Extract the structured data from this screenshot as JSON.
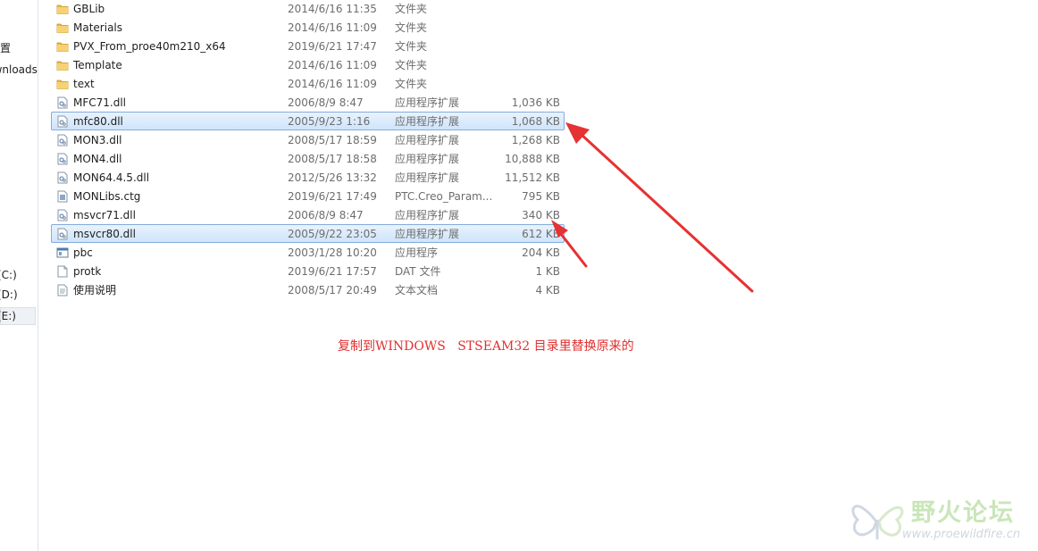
{
  "sidebar": {
    "items": [
      {
        "label": "位置"
      },
      {
        "label": "Downloads"
      },
      {
        "label": "(C:)"
      },
      {
        "label": "(D:)"
      },
      {
        "label": "(E:)"
      }
    ]
  },
  "files": [
    {
      "name": "GBLib",
      "date": "2014/6/16 11:35",
      "type": "文件夹",
      "size": "",
      "icon": "folder-icon",
      "selected": false
    },
    {
      "name": "Materials",
      "date": "2014/6/16 11:09",
      "type": "文件夹",
      "size": "",
      "icon": "folder-icon",
      "selected": false
    },
    {
      "name": "PVX_From_proe40m210_x64",
      "date": "2019/6/21 17:47",
      "type": "文件夹",
      "size": "",
      "icon": "folder-icon",
      "selected": false
    },
    {
      "name": "Template",
      "date": "2014/6/16 11:09",
      "type": "文件夹",
      "size": "",
      "icon": "folder-icon",
      "selected": false
    },
    {
      "name": "text",
      "date": "2014/6/16 11:09",
      "type": "文件夹",
      "size": "",
      "icon": "folder-icon",
      "selected": false
    },
    {
      "name": "MFC71.dll",
      "date": "2006/8/9 8:47",
      "type": "应用程序扩展",
      "size": "1,036 KB",
      "icon": "dll-file-icon",
      "selected": false
    },
    {
      "name": "mfc80.dll",
      "date": "2005/9/23 1:16",
      "type": "应用程序扩展",
      "size": "1,068 KB",
      "icon": "dll-file-icon",
      "selected": true
    },
    {
      "name": "MON3.dll",
      "date": "2008/5/17 18:59",
      "type": "应用程序扩展",
      "size": "1,268 KB",
      "icon": "dll-file-icon",
      "selected": false
    },
    {
      "name": "MON4.dll",
      "date": "2008/5/17 18:58",
      "type": "应用程序扩展",
      "size": "10,888 KB",
      "icon": "dll-file-icon",
      "selected": false
    },
    {
      "name": "MON64.4.5.dll",
      "date": "2012/5/26 13:32",
      "type": "应用程序扩展",
      "size": "11,512 KB",
      "icon": "dll-file-icon",
      "selected": false
    },
    {
      "name": "MONLibs.ctg",
      "date": "2019/6/21 17:49",
      "type": "PTC.Creo_Param...",
      "size": "795 KB",
      "icon": "ctg-file-icon",
      "selected": false
    },
    {
      "name": "msvcr71.dll",
      "date": "2006/8/9 8:47",
      "type": "应用程序扩展",
      "size": "340 KB",
      "icon": "dll-file-icon",
      "selected": false
    },
    {
      "name": "msvcr80.dll",
      "date": "2005/9/22 23:05",
      "type": "应用程序扩展",
      "size": "612 KB",
      "icon": "dll-file-icon",
      "selected": true
    },
    {
      "name": "pbc",
      "date": "2003/1/28 10:20",
      "type": "应用程序",
      "size": "204 KB",
      "icon": "exe-file-icon",
      "selected": false
    },
    {
      "name": "protk",
      "date": "2019/6/21 17:57",
      "type": "DAT 文件",
      "size": "1 KB",
      "icon": "blank-file-icon",
      "selected": false
    },
    {
      "name": "使用说明",
      "date": "2008/5/17 20:49",
      "type": "文本文档",
      "size": "4 KB",
      "icon": "text-file-icon",
      "selected": false
    }
  ],
  "annotation": {
    "text": "复制到WINDOWS   STSEAM32 目录里替换原来的",
    "color": "#e03030"
  },
  "watermark": {
    "title": "野火论坛",
    "url": "www.proewildfire.cn",
    "color": "#c9e6b8"
  },
  "colors": {
    "arrow": "#e63232",
    "selection_border": "#84acdd"
  }
}
